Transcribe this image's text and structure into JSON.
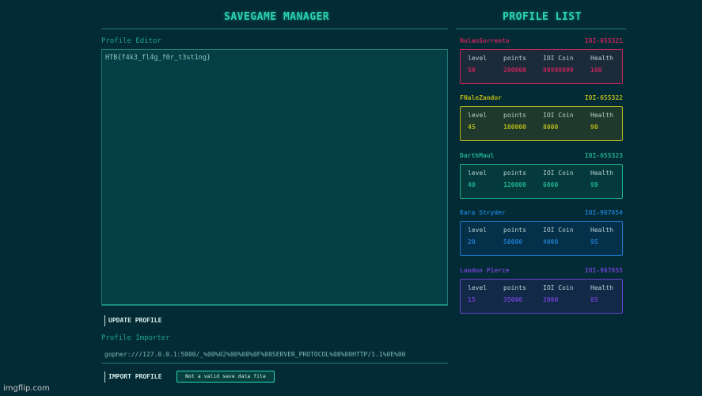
{
  "left": {
    "title": "SAVEGAME MANAGER",
    "editor_label": "Profile Editor",
    "editor_value": "HTB{f4k3_fl4g_f0r_t3st1ng}",
    "update_button": "UPDATE PROFILE",
    "importer_label": "Profile Importer",
    "importer_value": "gopher:///127.0.0.1:5000/_%00%02%00%00%0F%00SERVER_PROTOCOL%08%00HTTP/1.1%0E%00",
    "import_button": "IMPORT PROFILE",
    "toast": "Not a valid save data file"
  },
  "right": {
    "title": "PROFILE LIST",
    "headers": [
      "level",
      "points",
      "IOI Coin",
      "Health"
    ],
    "profiles": [
      {
        "name": "NolanSorrento",
        "id": "IOI-655321",
        "color": "#c0245a",
        "bg": "#1c2b3a",
        "values": [
          "50",
          "200000",
          "99999999",
          "100"
        ]
      },
      {
        "name": "FNaleZandor",
        "id": "IOI-655322",
        "color": "#b3b41a",
        "bg": "#1f3a2c",
        "values": [
          "45",
          "180000",
          "8000",
          "90"
        ]
      },
      {
        "name": "DarthMaul",
        "id": "IOI-655323",
        "color": "#1dae8a",
        "bg": "#053a3c",
        "values": [
          "40",
          "120000",
          "6000",
          "99"
        ]
      },
      {
        "name": "Kara Stryder",
        "id": "IOI-987654",
        "color": "#1b78c6",
        "bg": "#04304a",
        "values": [
          "20",
          "50000",
          "4000",
          "95"
        ]
      },
      {
        "name": "Landon Pierce",
        "id": "IOI-987655",
        "color": "#6a3fc8",
        "bg": "#122a48",
        "values": [
          "15",
          "35000",
          "2000",
          "85"
        ]
      }
    ]
  },
  "watermark": "imgflip.com"
}
